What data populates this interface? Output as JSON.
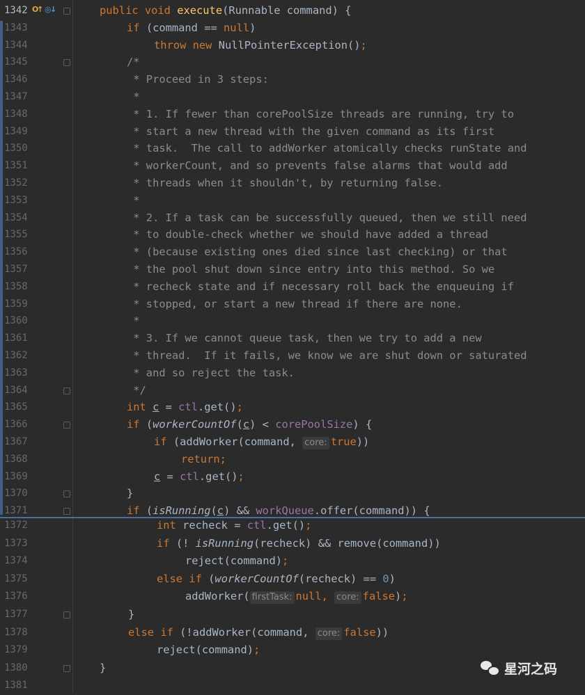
{
  "lines_top": [
    {
      "n": "1342",
      "indent": 0,
      "tokens": [
        [
          "kw",
          "public "
        ],
        [
          "kw",
          "void "
        ],
        [
          "fn",
          "execute"
        ],
        [
          "",
          "(Runnable command) {"
        ]
      ]
    },
    {
      "n": "1343",
      "indent": 1,
      "tokens": [
        [
          "kw",
          "if "
        ],
        [
          "",
          "(command "
        ],
        [
          "",
          "== "
        ],
        [
          "kw",
          "null"
        ],
        [
          "",
          ")"
        ]
      ]
    },
    {
      "n": "1344",
      "indent": 2,
      "tokens": [
        [
          "kw",
          "throw "
        ],
        [
          "kw",
          "new "
        ],
        [
          "",
          "NullPointerException()"
        ],
        [
          "kw",
          ";"
        ]
      ]
    },
    {
      "n": "1345",
      "indent": 1,
      "tokens": [
        [
          "cm",
          "/*"
        ]
      ]
    },
    {
      "n": "1346",
      "indent": 1,
      "tokens": [
        [
          "cm",
          " * Proceed in 3 steps:"
        ]
      ]
    },
    {
      "n": "1347",
      "indent": 1,
      "tokens": [
        [
          "cm",
          " *"
        ]
      ]
    },
    {
      "n": "1348",
      "indent": 1,
      "tokens": [
        [
          "cm",
          " * 1. If fewer than corePoolSize threads are running, try to"
        ]
      ]
    },
    {
      "n": "1349",
      "indent": 1,
      "tokens": [
        [
          "cm",
          " * start a new thread with the given command as its first"
        ]
      ]
    },
    {
      "n": "1350",
      "indent": 1,
      "tokens": [
        [
          "cm",
          " * task.  The call to addWorker atomically checks runState and"
        ]
      ]
    },
    {
      "n": "1351",
      "indent": 1,
      "tokens": [
        [
          "cm",
          " * workerCount, and so prevents false alarms that would add"
        ]
      ]
    },
    {
      "n": "1352",
      "indent": 1,
      "tokens": [
        [
          "cm",
          " * threads when it shouldn't, by returning false."
        ]
      ]
    },
    {
      "n": "1353",
      "indent": 1,
      "tokens": [
        [
          "cm",
          " *"
        ]
      ]
    },
    {
      "n": "1354",
      "indent": 1,
      "tokens": [
        [
          "cm",
          " * 2. If a task can be successfully queued, then we still need"
        ]
      ]
    },
    {
      "n": "1355",
      "indent": 1,
      "tokens": [
        [
          "cm",
          " * to double-check whether we should have added a thread"
        ]
      ]
    },
    {
      "n": "1356",
      "indent": 1,
      "tokens": [
        [
          "cm",
          " * (because existing ones died since last checking) or that"
        ]
      ]
    },
    {
      "n": "1357",
      "indent": 1,
      "tokens": [
        [
          "cm",
          " * the pool shut down since entry into this method. So we"
        ]
      ]
    },
    {
      "n": "1358",
      "indent": 1,
      "tokens": [
        [
          "cm",
          " * recheck state and if necessary roll back the enqueuing if"
        ]
      ]
    },
    {
      "n": "1359",
      "indent": 1,
      "tokens": [
        [
          "cm",
          " * stopped, or start a new thread if there are none."
        ]
      ]
    },
    {
      "n": "1360",
      "indent": 1,
      "tokens": [
        [
          "cm",
          " *"
        ]
      ]
    },
    {
      "n": "1361",
      "indent": 1,
      "tokens": [
        [
          "cm",
          " * 3. If we cannot queue task, then we try to add a new"
        ]
      ]
    },
    {
      "n": "1362",
      "indent": 1,
      "tokens": [
        [
          "cm",
          " * thread.  If it fails, we know we are shut down or saturated"
        ]
      ]
    },
    {
      "n": "1363",
      "indent": 1,
      "tokens": [
        [
          "cm",
          " * and so reject the task."
        ]
      ]
    },
    {
      "n": "1364",
      "indent": 1,
      "tokens": [
        [
          "cm",
          " */"
        ]
      ]
    },
    {
      "n": "1365",
      "indent": 1,
      "tokens": [
        [
          "kw",
          "int "
        ],
        [
          "ul",
          "c"
        ],
        [
          "",
          " = "
        ],
        [
          "fld",
          "ctl"
        ],
        [
          "",
          ".get()"
        ],
        [
          "kw",
          ";"
        ]
      ]
    },
    {
      "n": "1366",
      "indent": 1,
      "tokens": [
        [
          "kw",
          "if "
        ],
        [
          "",
          "("
        ],
        [
          "st",
          "workerCountOf"
        ],
        [
          "",
          "("
        ],
        [
          "ul",
          "c"
        ],
        [
          "",
          ") < "
        ],
        [
          "fld",
          "corePoolSize"
        ],
        [
          "",
          ") {"
        ]
      ]
    },
    {
      "n": "1367",
      "indent": 2,
      "tokens": [
        [
          "kw",
          "if "
        ],
        [
          "",
          "(addWorker(command, "
        ],
        [
          "hint",
          "core:"
        ],
        [
          "kw",
          "true"
        ],
        [
          "",
          "))"
        ]
      ]
    },
    {
      "n": "1368",
      "indent": 3,
      "tokens": [
        [
          "kw",
          "return;"
        ]
      ]
    },
    {
      "n": "1369",
      "indent": 2,
      "tokens": [
        [
          "ul",
          "c"
        ],
        [
          "",
          " = "
        ],
        [
          "fld",
          "ctl"
        ],
        [
          "",
          ".get()"
        ],
        [
          "kw",
          ";"
        ]
      ]
    },
    {
      "n": "1370",
      "indent": 1,
      "tokens": [
        [
          "",
          "}"
        ]
      ]
    },
    {
      "n": "1371",
      "indent": 1,
      "tokens": [
        [
          "kw",
          "if "
        ],
        [
          "",
          "("
        ],
        [
          "st",
          "isRunning"
        ],
        [
          "",
          "("
        ],
        [
          "ul",
          "c"
        ],
        [
          "",
          ") && "
        ],
        [
          "fld",
          "workQueue"
        ],
        [
          "",
          ".offer(command)) {"
        ]
      ]
    }
  ],
  "lines_bottom": [
    {
      "n": "1372",
      "indent": 2,
      "tokens": [
        [
          "kw",
          "int "
        ],
        [
          "",
          "recheck = "
        ],
        [
          "fld",
          "ctl"
        ],
        [
          "",
          ".get()"
        ],
        [
          "kw",
          ";"
        ]
      ]
    },
    {
      "n": "1373",
      "indent": 2,
      "tokens": [
        [
          "kw",
          "if "
        ],
        [
          "",
          "(! "
        ],
        [
          "st",
          "isRunning"
        ],
        [
          "",
          "(recheck) && remove(command))"
        ]
      ]
    },
    {
      "n": "1374",
      "indent": 3,
      "tokens": [
        [
          "",
          "reject(command)"
        ],
        [
          "kw",
          ";"
        ]
      ]
    },
    {
      "n": "1375",
      "indent": 2,
      "tokens": [
        [
          "kw",
          "else if "
        ],
        [
          "",
          "("
        ],
        [
          "st",
          "workerCountOf"
        ],
        [
          "",
          "(recheck) "
        ],
        [
          "",
          "== "
        ],
        [
          "num",
          "0"
        ],
        [
          "",
          ")"
        ]
      ]
    },
    {
      "n": "1376",
      "indent": 3,
      "tokens": [
        [
          "",
          "addWorker("
        ],
        [
          "hint",
          "firstTask:"
        ],
        [
          "kw",
          "null, "
        ],
        [
          "hint",
          "core:"
        ],
        [
          "kw",
          "false"
        ],
        [
          "",
          ")"
        ],
        [
          "kw",
          ";"
        ]
      ]
    },
    {
      "n": "1377",
      "indent": 1,
      "tokens": [
        [
          "",
          "}"
        ]
      ]
    },
    {
      "n": "1378",
      "indent": 1,
      "tokens": [
        [
          "kw",
          "else if "
        ],
        [
          "",
          "(!addWorker(command, "
        ],
        [
          "hint",
          "core:"
        ],
        [
          "kw",
          "false"
        ],
        [
          "",
          "))"
        ]
      ]
    },
    {
      "n": "1379",
      "indent": 2,
      "tokens": [
        [
          "",
          "reject(command)"
        ],
        [
          "kw",
          ";"
        ]
      ]
    },
    {
      "n": "1380",
      "indent": 0,
      "tokens": [
        [
          "",
          "}"
        ]
      ]
    },
    {
      "n": "1381",
      "indent": 0,
      "tokens": []
    }
  ],
  "folds_top": [
    "1342",
    "1345",
    "1364",
    "1366",
    "1370",
    "1371"
  ],
  "folds_bottom": [
    "1377",
    "1380"
  ],
  "gutter_icons": [
    {
      "glyph": "O",
      "color": "#e2a246",
      "name": "override-icon"
    },
    {
      "glyph": "↑",
      "color": "#e2a246",
      "name": "overrides-up-arrow-icon"
    },
    {
      "glyph": "◎",
      "color": "#4f9fd6",
      "name": "implemented-icon"
    },
    {
      "glyph": "↓",
      "color": "#4f9fd6",
      "name": "implemented-down-arrow-icon"
    }
  ],
  "watermark": {
    "text": "星河之码",
    "icon": "wechat-icon"
  }
}
